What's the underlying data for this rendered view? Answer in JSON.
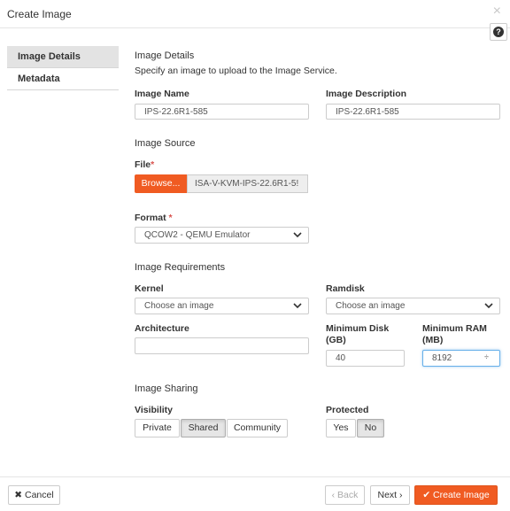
{
  "modal": {
    "title": "Create Image",
    "close_label": "×",
    "help_label": "?"
  },
  "nav": [
    {
      "label": "Image Details",
      "active": true
    },
    {
      "label": "Metadata",
      "active": false
    }
  ],
  "details": {
    "heading": "Image Details",
    "description": "Specify an image to upload to the Image Service.",
    "image_name": {
      "label": "Image Name",
      "value": "IPS-22.6R1-585"
    },
    "image_description": {
      "label": "Image Description",
      "value": "IPS-22.6R1-585"
    }
  },
  "source": {
    "heading": "Image Source",
    "file_label": "File",
    "required_mark": "*",
    "browse_label": "Browse...",
    "file_name": "ISA-V-KVM-IPS-22.6R1-5!",
    "format_label": "Format",
    "format_value": "QCOW2 - QEMU Emulator"
  },
  "requirements": {
    "heading": "Image Requirements",
    "kernel_label": "Kernel",
    "kernel_value": "Choose an image",
    "ramdisk_label": "Ramdisk",
    "ramdisk_value": "Choose an image",
    "architecture_label": "Architecture",
    "architecture_value": "",
    "min_disk_label_1": "Minimum Disk",
    "min_disk_label_2": "(GB)",
    "min_disk_value": "40",
    "min_ram_label_1": "Minimum RAM",
    "min_ram_label_2": "(MB)",
    "min_ram_value": "8192",
    "stepper_glyph": "÷"
  },
  "sharing": {
    "heading": "Image Sharing",
    "visibility_label": "Visibility",
    "visibility_options": [
      "Private",
      "Shared",
      "Community"
    ],
    "visibility_selected": "Shared",
    "protected_label": "Protected",
    "protected_options": [
      "Yes",
      "No"
    ],
    "protected_selected": "No"
  },
  "footer": {
    "cancel_label": "✖ Cancel",
    "back_label": "‹ Back",
    "next_label": "Next ›",
    "create_label": "✔ Create Image"
  },
  "colors": {
    "accent": "#f05b22",
    "required": "#d9534f"
  }
}
